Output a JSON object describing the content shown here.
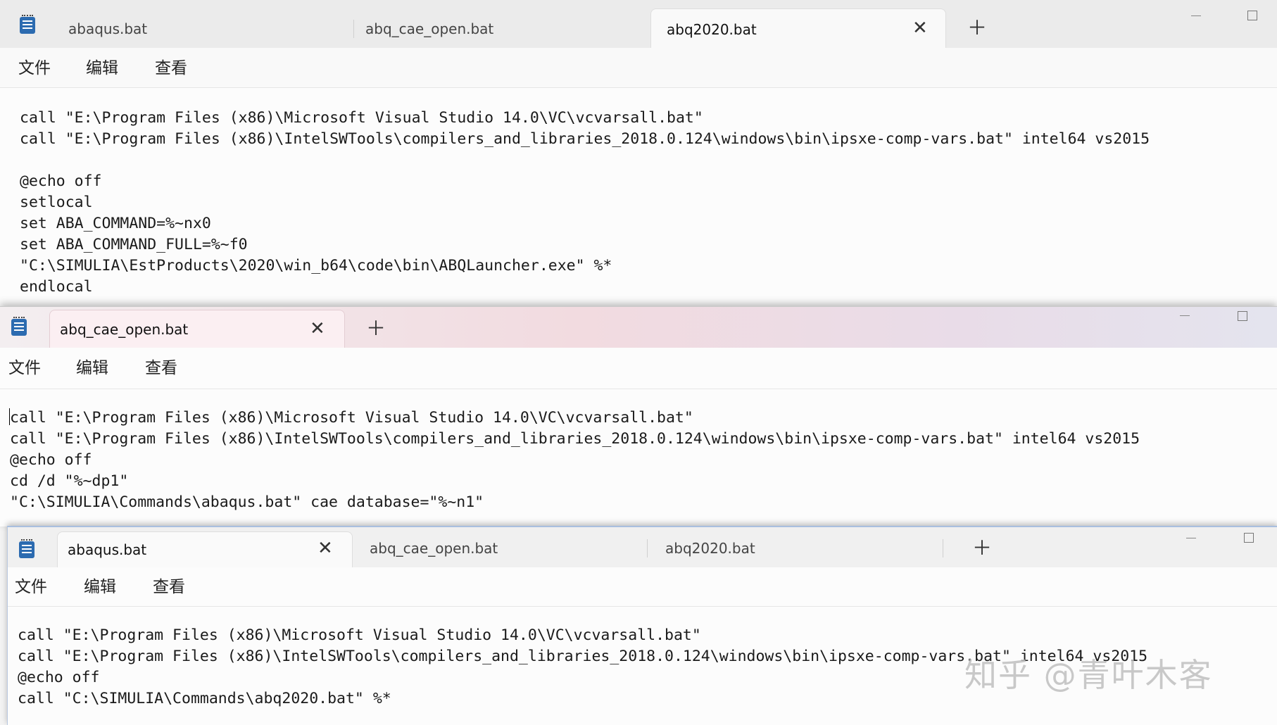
{
  "windows": {
    "back": {
      "tabs": [
        {
          "label": "abaqus.bat"
        },
        {
          "label": "abq_cae_open.bat"
        },
        {
          "label": "abq2020.bat"
        }
      ],
      "menu": [
        "文件",
        "编辑",
        "查看"
      ],
      "lines": [
        "call \"E:\\Program Files (x86)\\Microsoft Visual Studio 14.0\\VC\\vcvarsall.bat\"",
        "call \"E:\\Program Files (x86)\\IntelSWTools\\compilers_and_libraries_2018.0.124\\windows\\bin\\ipsxe-comp-vars.bat\" intel64 vs2015",
        "",
        "@echo off",
        "setlocal",
        "set ABA_COMMAND=%~nx0",
        "set ABA_COMMAND_FULL=%~f0",
        "\"C:\\SIMULIA\\EstProducts\\2020\\win_b64\\code\\bin\\ABQLauncher.exe\" %*",
        "endlocal"
      ]
    },
    "middle": {
      "tabs": [
        {
          "label": "abq_cae_open.bat"
        }
      ],
      "menu": [
        "文件",
        "编辑",
        "查看"
      ],
      "lines": [
        "call \"E:\\Program Files (x86)\\Microsoft Visual Studio 14.0\\VC\\vcvarsall.bat\"",
        "call \"E:\\Program Files (x86)\\IntelSWTools\\compilers_and_libraries_2018.0.124\\windows\\bin\\ipsxe-comp-vars.bat\" intel64 vs2015",
        "@echo off",
        "cd /d \"%~dp1\"",
        "\"C:\\SIMULIA\\Commands\\abaqus.bat\" cae database=\"%~n1\""
      ]
    },
    "front": {
      "tabs": [
        {
          "label": "abaqus.bat"
        },
        {
          "label": "abq_cae_open.bat"
        },
        {
          "label": "abq2020.bat"
        }
      ],
      "menu": [
        "文件",
        "编辑",
        "查看"
      ],
      "lines": [
        "call \"E:\\Program Files (x86)\\Microsoft Visual Studio 14.0\\VC\\vcvarsall.bat\"",
        "call \"E:\\Program Files (x86)\\IntelSWTools\\compilers_and_libraries_2018.0.124\\windows\\bin\\ipsxe-comp-vars.bat\" intel64 vs2015",
        "@echo off",
        "call \"C:\\SIMULIA\\Commands\\abq2020.bat\" %*"
      ]
    }
  },
  "icons": {
    "app": "notepad-icon",
    "close_tab": "close-icon",
    "new_tab": "plus-icon",
    "minimize": "minimize-icon",
    "maximize": "maximize-icon"
  },
  "watermark": "知乎 @青叶木客"
}
